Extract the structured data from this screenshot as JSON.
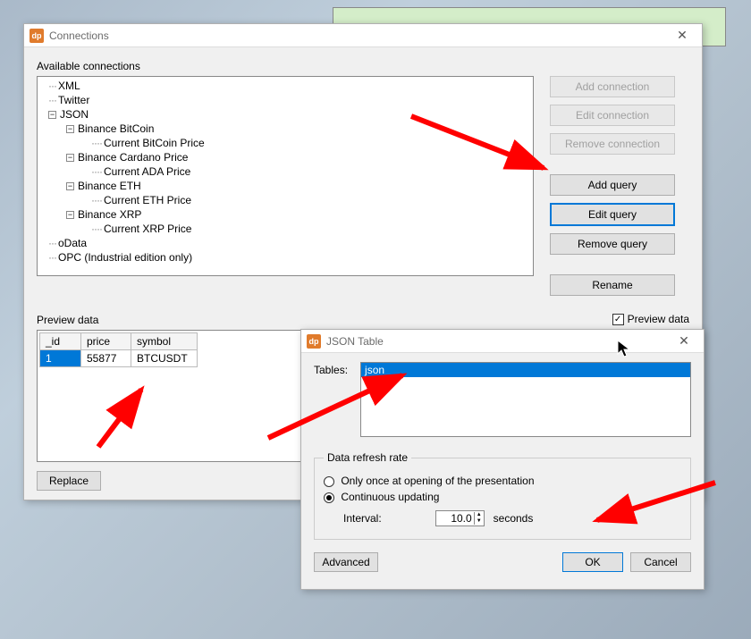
{
  "connections_window": {
    "title": "Connections",
    "available_label": "Available connections",
    "tree": {
      "xml": "XML",
      "twitter": "Twitter",
      "json": "JSON",
      "bitcoin": "Binance BitCoin",
      "bitcoin_price": "Current BitCoin Price",
      "cardano": "Binance Cardano Price",
      "ada_price": "Current ADA Price",
      "eth": "Binance ETH",
      "eth_price": "Current ETH Price",
      "xrp": "Binance XRP",
      "xrp_price": "Current XRP Price",
      "odata": "oData",
      "opc": "OPC (Industrial edition only)"
    },
    "buttons": {
      "add_connection": "Add connection",
      "edit_connection": "Edit connection",
      "remove_connection": "Remove connection",
      "add_query": "Add query",
      "edit_query": "Edit query",
      "remove_query": "Remove query",
      "rename": "Rename",
      "replace": "Replace"
    },
    "preview_label": "Preview data",
    "preview_checkbox_label": "Preview data",
    "preview_checked": true,
    "table": {
      "headers": {
        "id": "_id",
        "price": "price",
        "symbol": "symbol"
      },
      "row": {
        "id": "1",
        "price": "55877",
        "symbol": "BTCUSDT"
      }
    }
  },
  "json_table_window": {
    "title": "JSON Table",
    "tables_label": "Tables:",
    "tables_selected": "json",
    "refresh_group": "Data refresh rate",
    "radio_once": "Only once at opening of the presentation",
    "radio_continuous": "Continuous updating",
    "interval_label": "Interval:",
    "interval_value": "10.0",
    "interval_unit": "seconds",
    "buttons": {
      "advanced": "Advanced",
      "ok": "OK",
      "cancel": "Cancel"
    }
  }
}
